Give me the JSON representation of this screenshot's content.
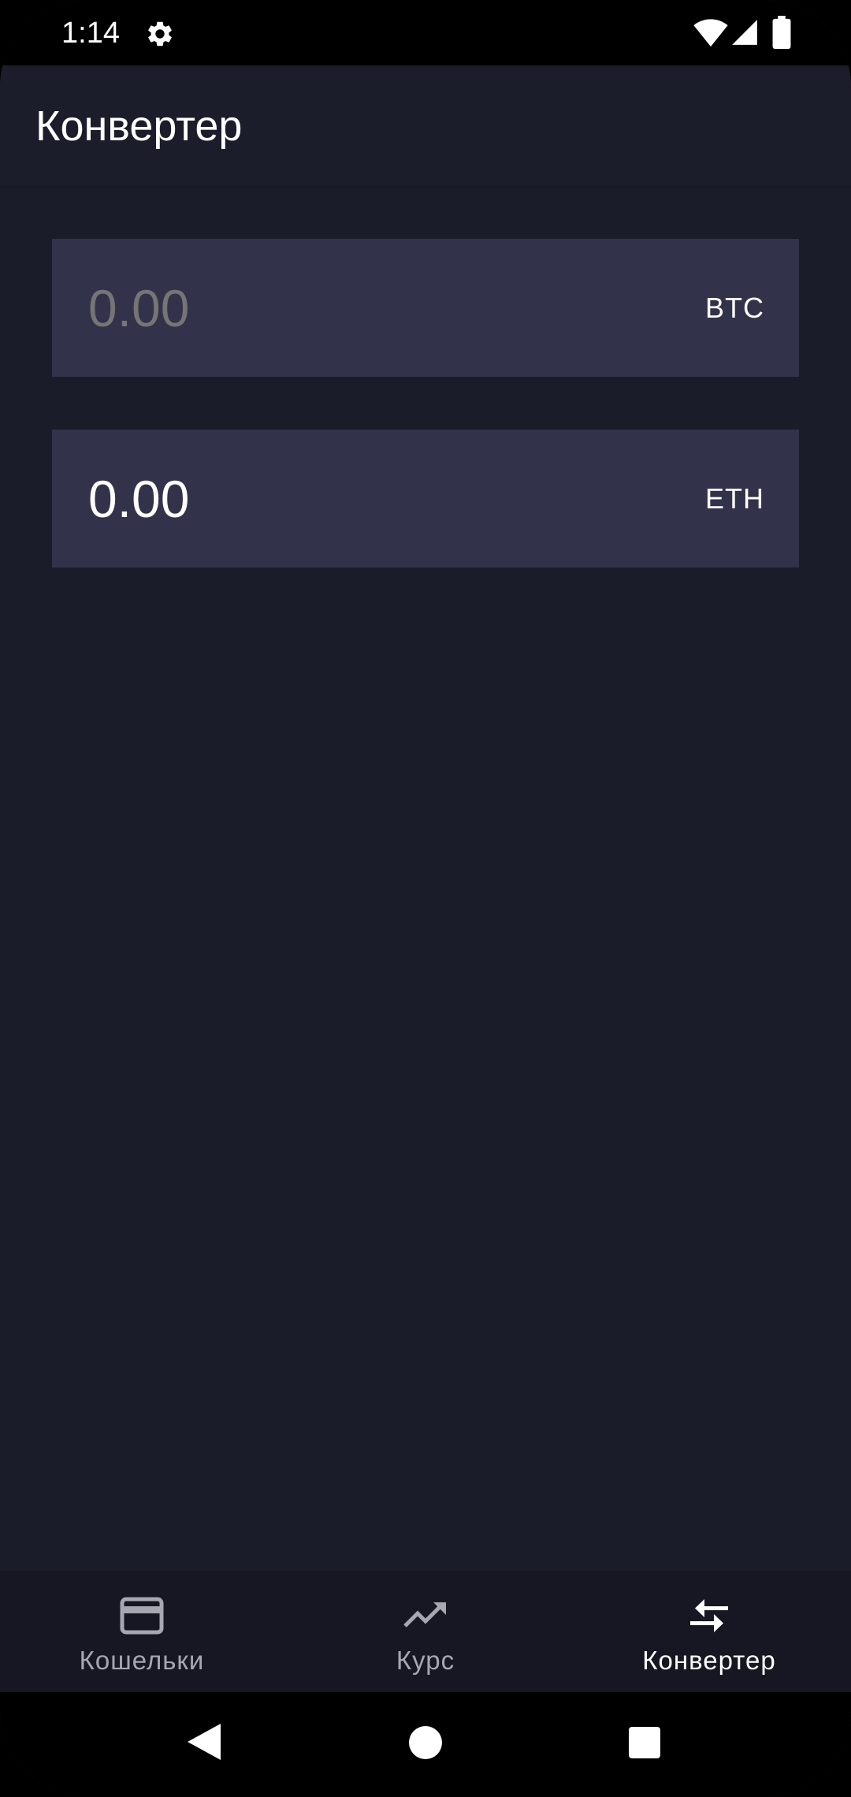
{
  "status_bar": {
    "time": "1:14",
    "icons": [
      "gear-icon",
      "wifi-icon",
      "signal-icon",
      "battery-icon"
    ]
  },
  "app_bar": {
    "title": "Конвертер"
  },
  "converter": {
    "from": {
      "value": "",
      "placeholder": "0.00",
      "currency": "BTC"
    },
    "to": {
      "value": "0.00",
      "currency": "ETH"
    }
  },
  "bottom_nav": {
    "items": [
      {
        "label": "Кошельки",
        "icon": "wallet-card-icon",
        "active": false
      },
      {
        "label": "Курс",
        "icon": "trending-up-icon",
        "active": false
      },
      {
        "label": "Конвертер",
        "icon": "compare-arrows-icon",
        "active": true
      }
    ]
  },
  "system_nav": {
    "buttons": [
      "back-icon",
      "home-icon",
      "recents-icon"
    ]
  },
  "colors": {
    "background": "#1b1c29",
    "app_bar": "#1c1d2b",
    "field": "#33324b",
    "bottom_nav": "#161722",
    "text_primary": "#ffffff",
    "text_inactive": "#a7a7b2",
    "placeholder": "#8e8d9f"
  }
}
